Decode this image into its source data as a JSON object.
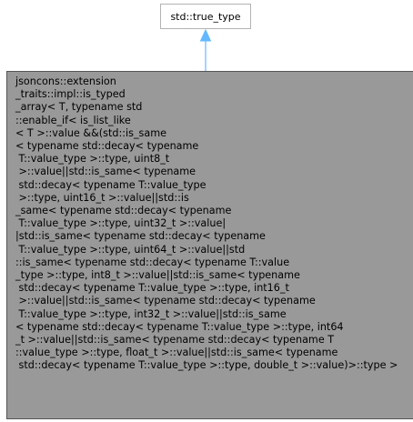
{
  "diagram": {
    "base_class": {
      "label": "std::true_type"
    },
    "derived_class": {
      "lines": [
        "jsoncons::extension",
        "_traits::impl::is_typed",
        "_array< T, typename std",
        "::enable_if< is_list_like",
        "< T >::value &&(std::is_same",
        "< typename std::decay< typename",
        " T::value_type >::type, uint8_t",
        " >::value||std::is_same< typename",
        " std::decay< typename T::value_type",
        " >::type, uint16_t >::value||std::is",
        "_same< typename std::decay< typename",
        " T::value_type >::type, uint32_t >::value|",
        "|std::is_same< typename std::decay< typename",
        " T::value_type >::type, uint64_t >::value||std",
        "::is_same< typename std::decay< typename T::value",
        "_type >::type, int8_t >::value||std::is_same< typename",
        " std::decay< typename T::value_type >::type, int16_t",
        " >::value||std::is_same< typename std::decay< typename",
        " T::value_type >::type, int32_t >::value||std::is_same",
        "< typename std::decay< typename T::value_type >::type, int64",
        "_t >::value||std::is_same< typename std::decay< typename T",
        "::value_type >::type, float_t >::value||std::is_same< typename",
        " std::decay< typename T::value_type >::type, double_t >::value)>::type >"
      ]
    },
    "edge_color": "#63b8ff",
    "base_fill": "#ffffff",
    "derived_fill": "#999999"
  }
}
